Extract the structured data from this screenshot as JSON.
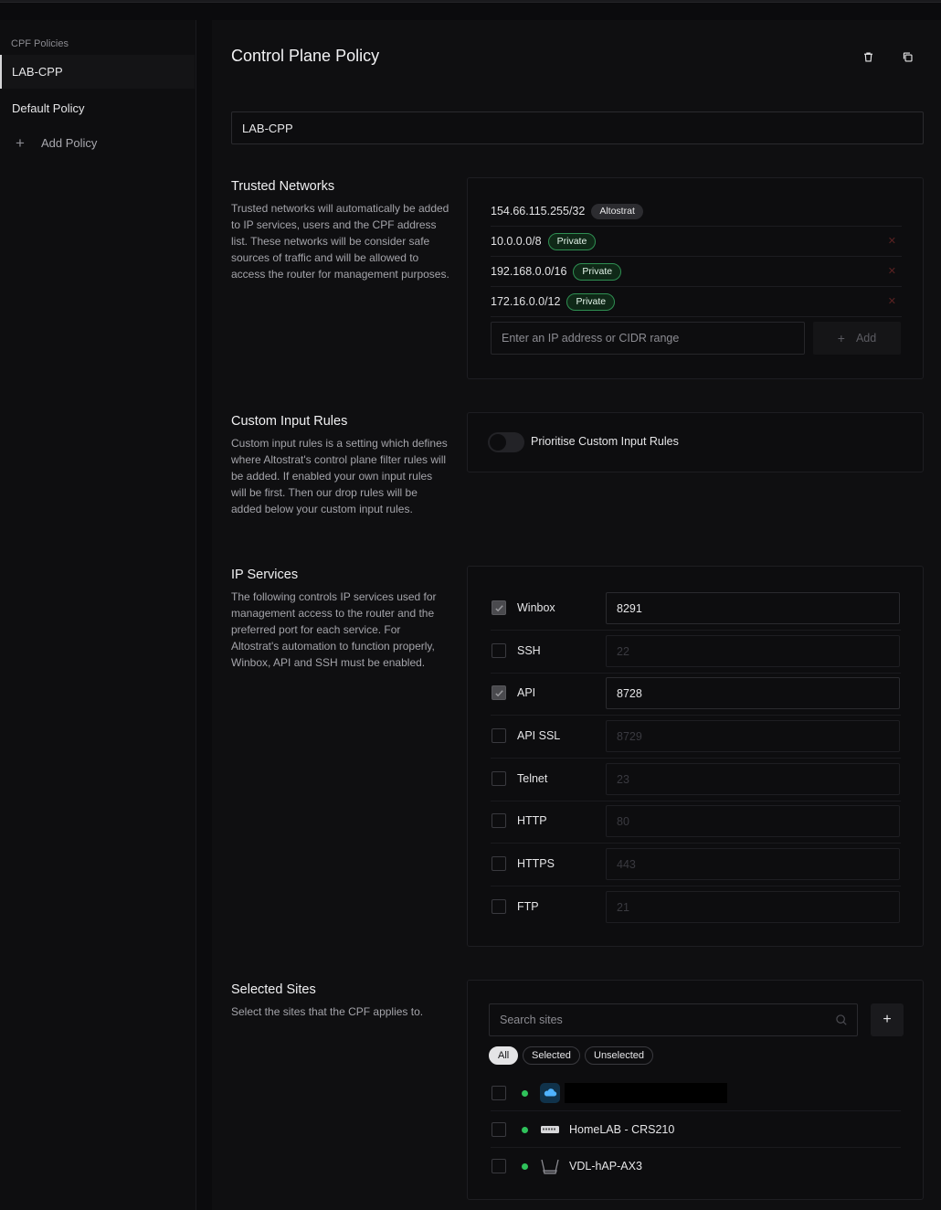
{
  "sidebar": {
    "heading": "CPF Policies",
    "items": [
      {
        "label": "LAB-CPP",
        "active": true
      },
      {
        "label": "Default Policy",
        "active": false
      }
    ],
    "add_label": "Add Policy"
  },
  "header": {
    "title": "Control Plane Policy",
    "delete_icon": "trash-icon",
    "copy_icon": "copy-icon"
  },
  "policy_name": {
    "value": "LAB-CPP"
  },
  "trusted_networks": {
    "title": "Trusted Networks",
    "description": "Trusted networks will automatically be added to IP services, users and the CPF address list. These networks will be consider safe sources of traffic and will be allowed to access the router for management purposes.",
    "networks": [
      {
        "address": "154.66.115.255/32",
        "badge": "Altostrat",
        "removable": false
      },
      {
        "address": "10.0.0.0/8",
        "badge": "Private",
        "removable": true
      },
      {
        "address": "192.168.0.0/16",
        "badge": "Private",
        "removable": true
      },
      {
        "address": "172.16.0.0/12",
        "badge": "Private",
        "removable": true
      }
    ],
    "remove_glyph": "✕",
    "input_placeholder": "Enter an IP address or CIDR range",
    "add_label": "Add",
    "add_glyph": "+"
  },
  "custom_input_rules": {
    "title": "Custom Input Rules",
    "description": "Custom input rules is a setting which defines where Altostrat's control plane filter rules will be added. If enabled your own input rules will be first. Then our drop rules will be added below your custom input rules.",
    "toggle_label": "Prioritise Custom Input Rules",
    "toggle_on": false
  },
  "ip_services": {
    "title": "IP Services",
    "description": "The following controls IP services used for management access to the router and the preferred port for each service. For Altostrat's automation to function properly, Winbox, API and SSH must be enabled.",
    "services": [
      {
        "name": "Winbox",
        "port": "8291",
        "enabled": true
      },
      {
        "name": "SSH",
        "port": "22",
        "enabled": false
      },
      {
        "name": "API",
        "port": "8728",
        "enabled": true
      },
      {
        "name": "API SSL",
        "port": "8729",
        "enabled": false
      },
      {
        "name": "Telnet",
        "port": "23",
        "enabled": false
      },
      {
        "name": "HTTP",
        "port": "80",
        "enabled": false
      },
      {
        "name": "HTTPS",
        "port": "443",
        "enabled": false
      },
      {
        "name": "FTP",
        "port": "21",
        "enabled": false
      }
    ]
  },
  "selected_sites": {
    "title": "Selected Sites",
    "description": "Select the sites that the CPF applies to.",
    "search_placeholder": "Search sites",
    "add_glyph": "+",
    "filters": [
      "All",
      "Selected",
      "Unselected"
    ],
    "active_filter": "All",
    "sites": [
      {
        "name": "",
        "icon": "cloud-icon",
        "status_color": "#2fc25b",
        "redacted": true
      },
      {
        "name": "HomeLAB - CRS210",
        "icon": "switch-icon",
        "status_color": "#2fc25b",
        "redacted": false
      },
      {
        "name": "VDL-hAP-AX3",
        "icon": "router-icon",
        "status_color": "#2fc25b",
        "redacted": false
      }
    ]
  },
  "colors": {
    "background": "#0b0b0d",
    "panel": "#0f0f11",
    "private_badge": "#2f8f52",
    "status_online": "#2fc25b"
  }
}
